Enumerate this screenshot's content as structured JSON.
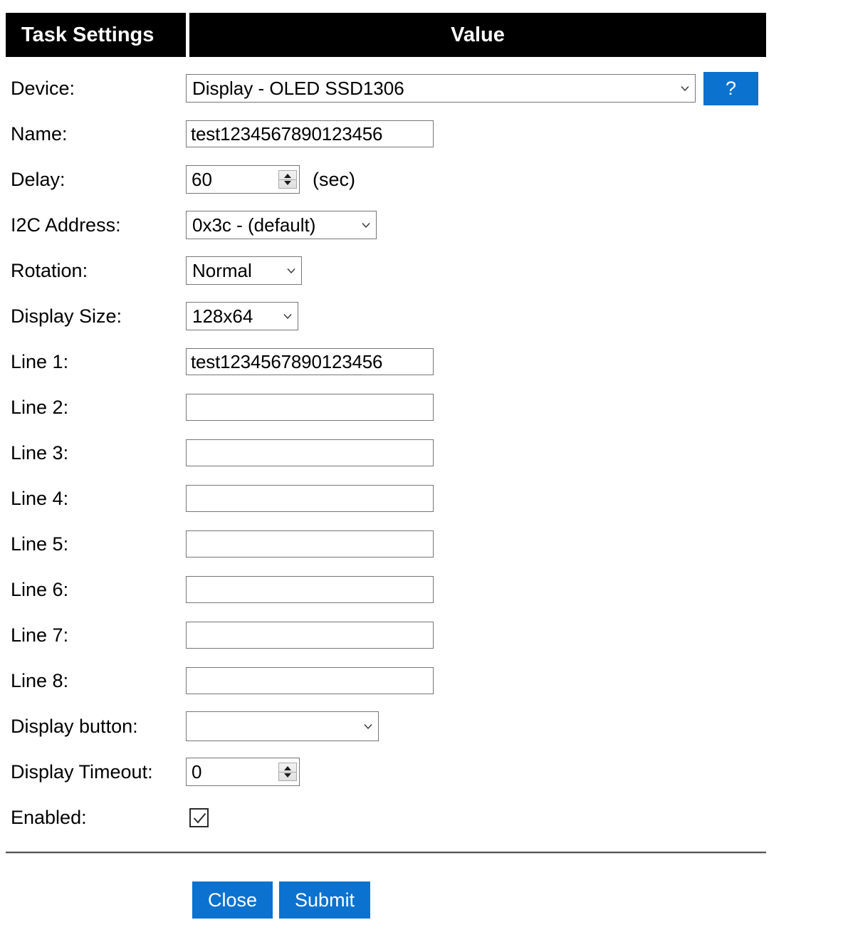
{
  "header": {
    "col_settings": "Task Settings",
    "col_value": "Value"
  },
  "rows": {
    "device": {
      "label": "Device:",
      "value": "Display - OLED SSD1306",
      "help_label": "?"
    },
    "name": {
      "label": "Name:",
      "value": "test1234567890123456"
    },
    "delay": {
      "label": "Delay:",
      "value": "60",
      "suffix": "(sec)"
    },
    "i2c_address": {
      "label": "I2C Address:",
      "value": "0x3c - (default)"
    },
    "rotation": {
      "label": "Rotation:",
      "value": "Normal"
    },
    "display_size": {
      "label": "Display Size:",
      "value": "128x64"
    },
    "lines": [
      {
        "label": "Line 1:",
        "value": "test1234567890123456"
      },
      {
        "label": "Line 2:",
        "value": ""
      },
      {
        "label": "Line 3:",
        "value": ""
      },
      {
        "label": "Line 4:",
        "value": ""
      },
      {
        "label": "Line 5:",
        "value": ""
      },
      {
        "label": "Line 6:",
        "value": ""
      },
      {
        "label": "Line 7:",
        "value": ""
      },
      {
        "label": "Line 8:",
        "value": ""
      }
    ],
    "display_button": {
      "label": "Display button:",
      "value": ""
    },
    "display_timeout": {
      "label": "Display Timeout:",
      "value": "0"
    },
    "enabled": {
      "label": "Enabled:",
      "checked": true
    }
  },
  "footer": {
    "close_label": "Close",
    "submit_label": "Submit"
  },
  "icons": {
    "chevron": "chevron-down-icon",
    "spinner": "spinner-updown-icon",
    "check": "checkmark-icon"
  },
  "colors": {
    "accent_blue": "#0b72cf",
    "header_bg": "#000000",
    "header_text": "#ffffff",
    "border_gray": "#767676",
    "divider": "#555555"
  }
}
